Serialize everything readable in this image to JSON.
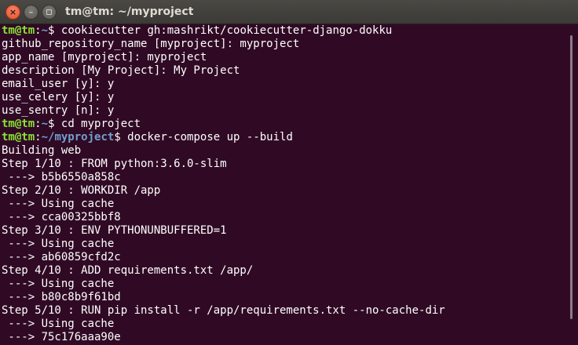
{
  "window": {
    "title": "tm@tm: ~/myproject",
    "close_glyph": "×",
    "minimize_glyph": "–"
  },
  "terminal": {
    "lines": [
      {
        "user": "tm@tm",
        "path": "~",
        "cmd": " cookiecutter gh:mashrikt/cookiecutter-django-dokku"
      },
      {
        "text": "github_repository_name [myproject]: myproject"
      },
      {
        "text": "app_name [myproject]: myproject"
      },
      {
        "text": "description [My Project]: My Project"
      },
      {
        "text": "email_user [y]: y"
      },
      {
        "text": "use_celery [y]: y"
      },
      {
        "text": "use_sentry [n]: y"
      },
      {
        "user": "tm@tm",
        "path": "~",
        "cmd": " cd myproject"
      },
      {
        "user": "tm@tm",
        "path": "~/myproject",
        "cmd": " docker-compose up --build"
      },
      {
        "text": "Building web"
      },
      {
        "text": "Step 1/10 : FROM python:3.6.0-slim"
      },
      {
        "text": " ---> b5b6550a858c"
      },
      {
        "text": "Step 2/10 : WORKDIR /app"
      },
      {
        "text": " ---> Using cache"
      },
      {
        "text": " ---> cca00325bbf8"
      },
      {
        "text": "Step 3/10 : ENV PYTHONUNBUFFERED=1"
      },
      {
        "text": " ---> Using cache"
      },
      {
        "text": " ---> ab60859cfd2c"
      },
      {
        "text": "Step 4/10 : ADD requirements.txt /app/"
      },
      {
        "text": " ---> Using cache"
      },
      {
        "text": " ---> b80c8b9f61bd"
      },
      {
        "text": "Step 5/10 : RUN pip install -r /app/requirements.txt --no-cache-dir"
      },
      {
        "text": " ---> Using cache"
      },
      {
        "text": " ---> 75c176aaa90e"
      }
    ]
  },
  "colors": {
    "background": "#300a24",
    "prompt_user": "#8ae234",
    "prompt_path": "#729fcf",
    "text": "#ffffff"
  }
}
